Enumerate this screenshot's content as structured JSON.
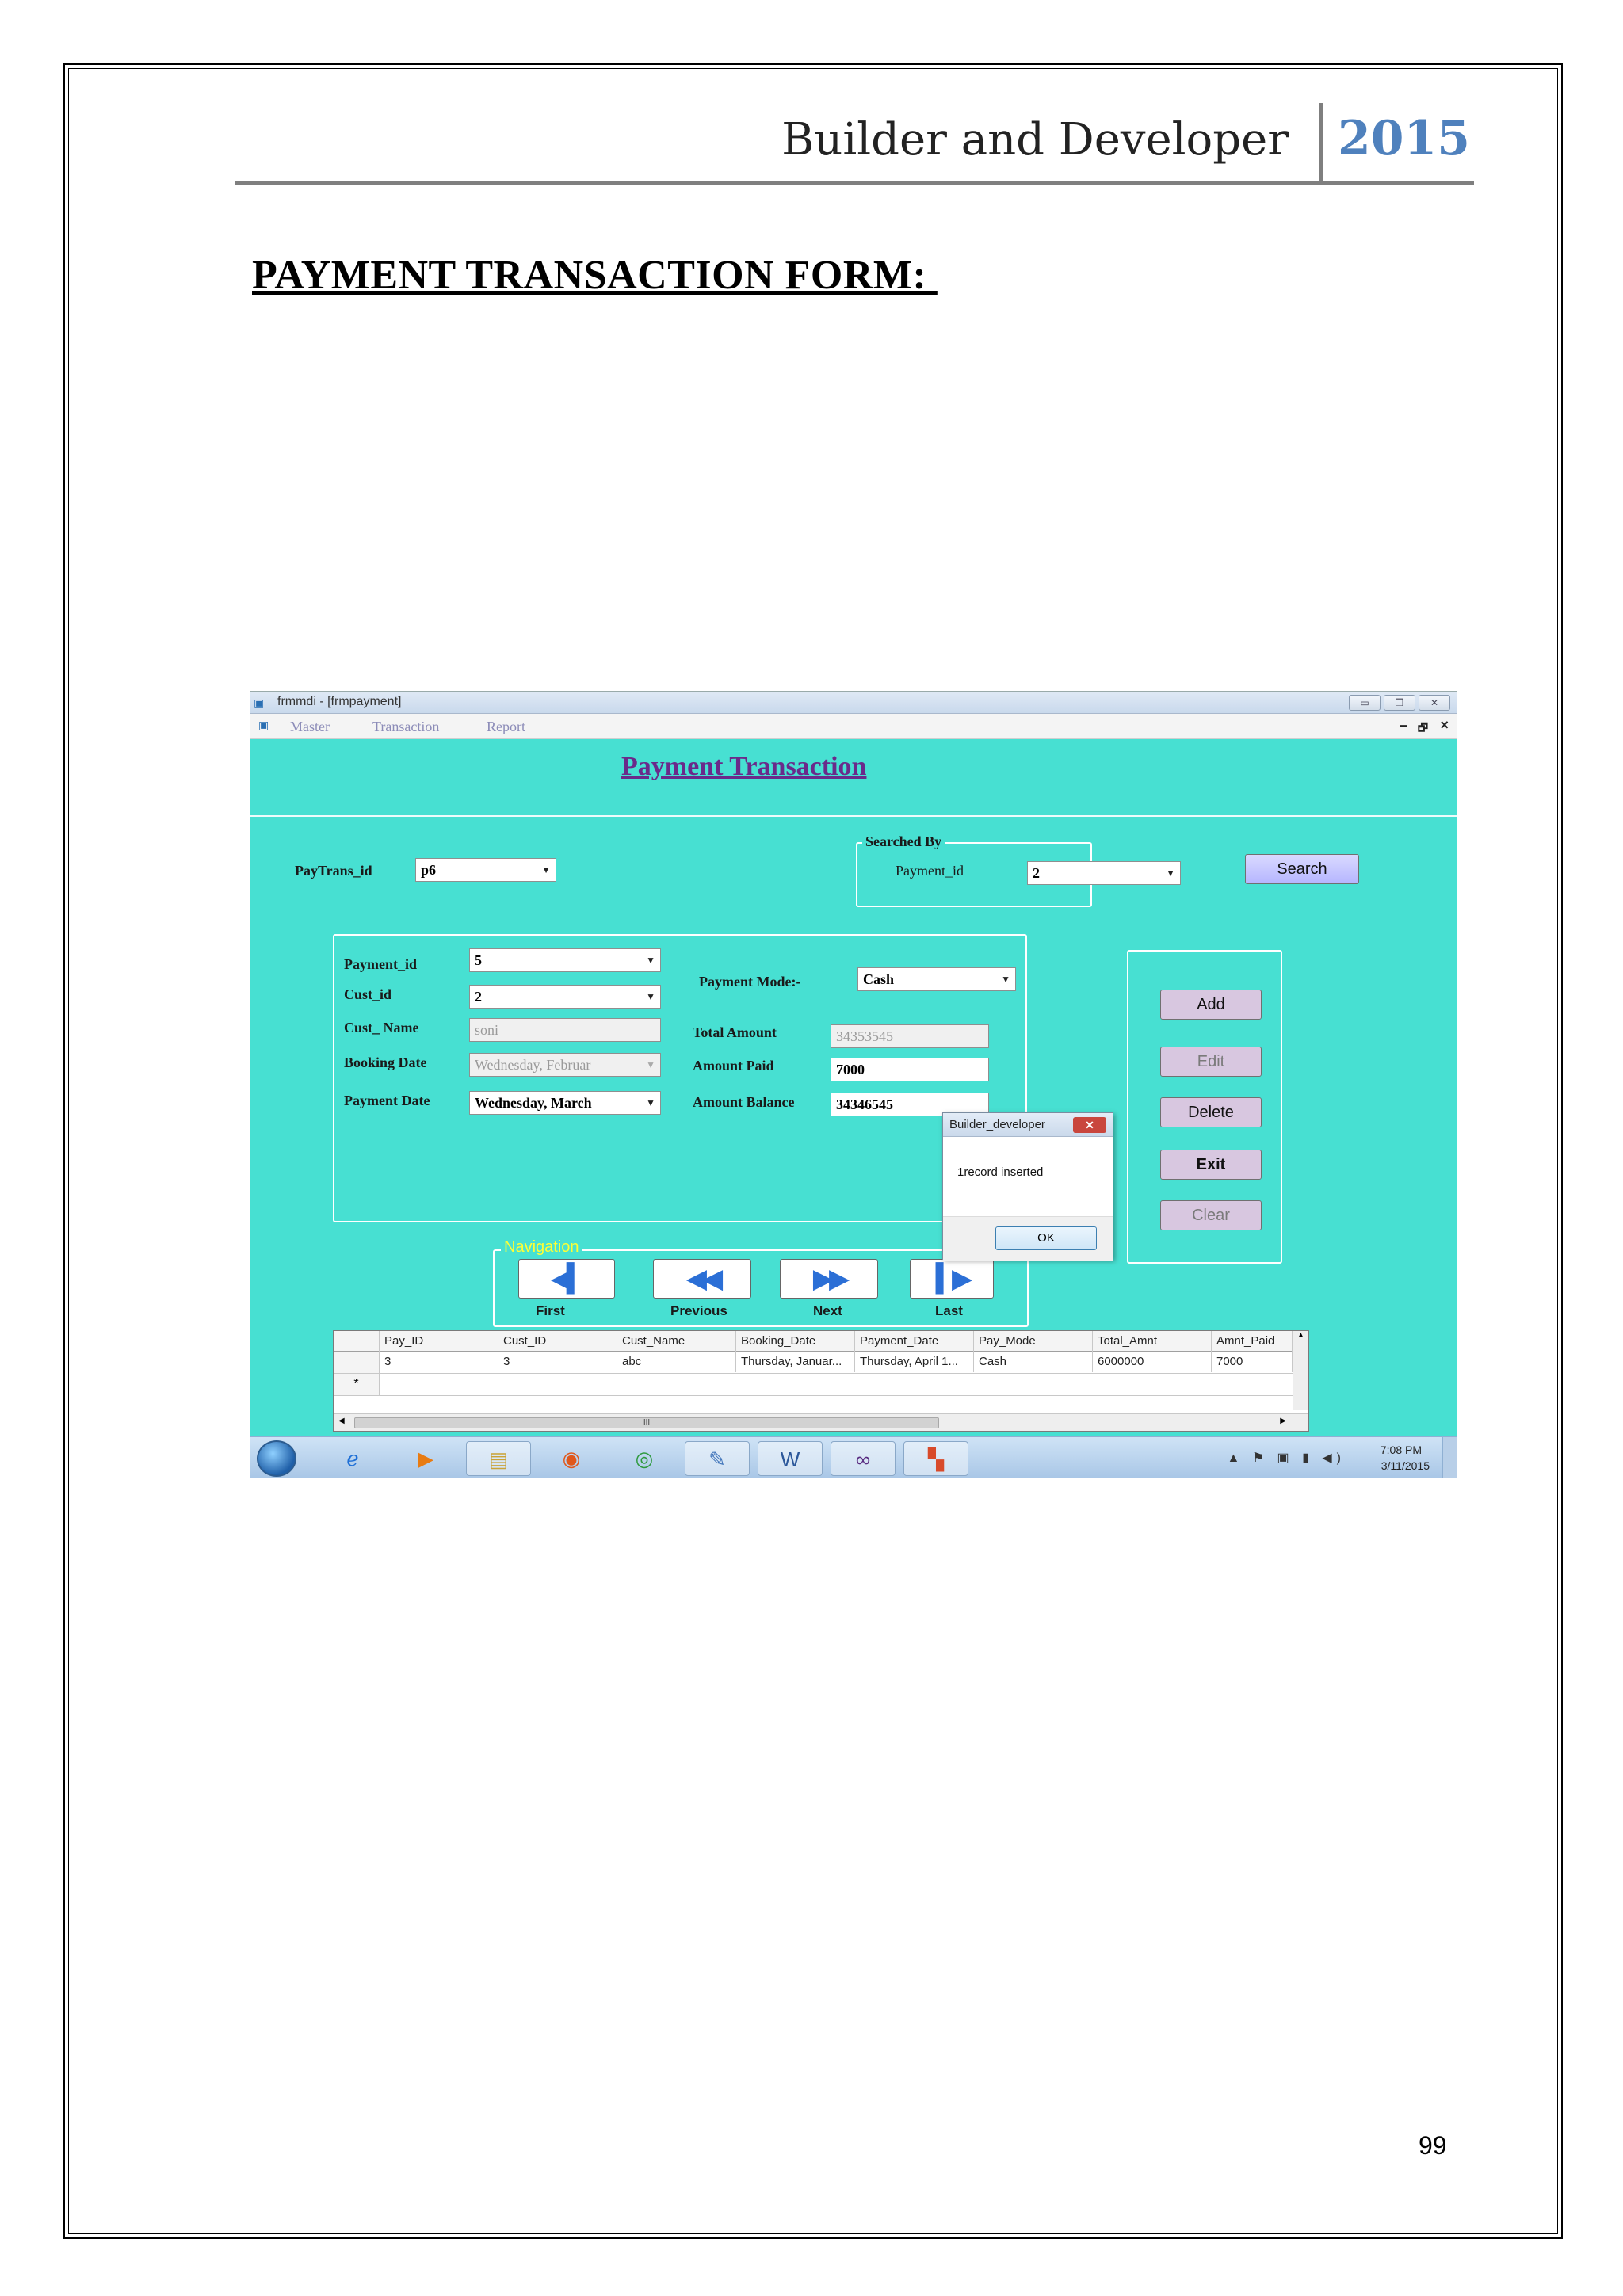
{
  "document": {
    "header_title": "Builder and Developer",
    "header_year": "2015",
    "section_heading": "PAYMENT TRANSACTION FORM: ",
    "page_number": "99"
  },
  "window": {
    "title": "frmmdi - [frmpayment]",
    "menu": [
      "Master",
      "Transaction",
      "Report"
    ],
    "mdi_controls": [
      "–",
      "🗗",
      "×"
    ]
  },
  "form": {
    "title": "Payment Transaction",
    "paytrans_label": "PayTrans_id",
    "paytrans_value": "p6",
    "searched_by_title": "Searched By",
    "search_payment_label": "Payment_id",
    "search_payment_value": "2",
    "search_button": "Search",
    "payment_id_label": "Payment_id",
    "payment_id_value": "5",
    "cust_id_label": "Cust_id",
    "cust_id_value": "2",
    "cust_name_label": "Cust_ Name",
    "cust_name_value": "soni",
    "booking_date_label": "Booking Date",
    "booking_date_value": "Wednesday,  Februar",
    "payment_date_label": "Payment Date",
    "payment_date_value": "Wednesday,     March",
    "payment_mode_label": "Payment Mode:-",
    "payment_mode_value": "Cash",
    "total_amount_label": "Total Amount",
    "total_amount_value": "34353545",
    "amount_paid_label": "Amount Paid",
    "amount_paid_value": "7000",
    "amount_balance_label": "Amount Balance",
    "amount_balance_value": "34346545",
    "buttons": {
      "add": "Add",
      "edit": "Edit",
      "delete": "Delete",
      "exit": "Exit",
      "clear": "Clear"
    },
    "navigation_title": "Navigation",
    "nav": {
      "first": "First",
      "previous": "Previous",
      "next": "Next",
      "last": "Last"
    }
  },
  "message_box": {
    "title": "Builder_developer",
    "close": "✕",
    "text": "1record inserted",
    "ok": "OK"
  },
  "grid": {
    "columns": [
      "Pay_ID",
      "Cust_ID",
      "Cust_Name",
      "Booking_Date",
      "Payment_Date",
      "Pay_Mode",
      "Total_Amnt",
      "Amnt_Paid"
    ],
    "rows": [
      [
        "3",
        "3",
        "abc",
        "Thursday, Januar...",
        "Thursday, April 1...",
        "Cash",
        "6000000",
        "7000"
      ]
    ],
    "new_row_marker": "*",
    "hscroll_label": "III"
  },
  "taskbar": {
    "icons": [
      "internet-explorer-icon",
      "media-player-icon",
      "file-explorer-icon",
      "firefox-icon",
      "chrome-icon",
      "paint-icon",
      "word-icon",
      "visual-studio-icon",
      "app-window-icon"
    ],
    "tray": "▲ ⚑ ▣ ▮ ◀)",
    "time": "7:08 PM",
    "date": "3/11/2015"
  }
}
